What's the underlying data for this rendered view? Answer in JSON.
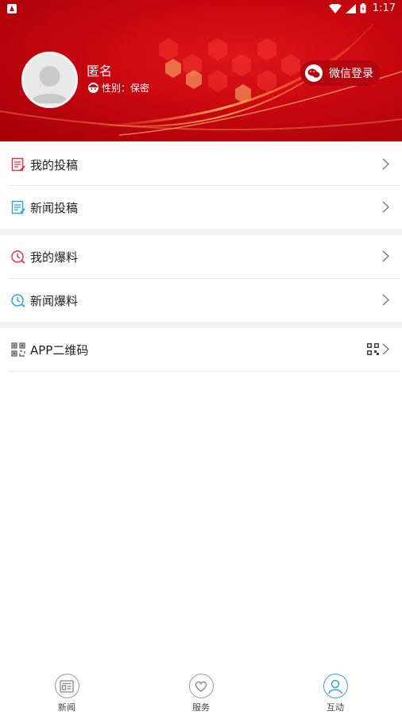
{
  "status_bar": {
    "time": "1:17"
  },
  "profile": {
    "name": "匿名",
    "gender_text": "性别：保密",
    "wechat_login": "微信登录"
  },
  "menu": {
    "my_submissions": "我的投稿",
    "news_submission": "新闻投稿",
    "my_tips": "我的爆料",
    "news_tips": "新闻爆料",
    "app_qrcode": "APP二维码"
  },
  "tabs": [
    {
      "label": "新闻",
      "icon": "newspaper-icon"
    },
    {
      "label": "服务",
      "icon": "heart-icon"
    },
    {
      "label": "互动",
      "icon": "user-icon",
      "active": true
    }
  ],
  "colors": {
    "brand_red": "#c8070f",
    "active_blue": "#3aa0e0"
  }
}
